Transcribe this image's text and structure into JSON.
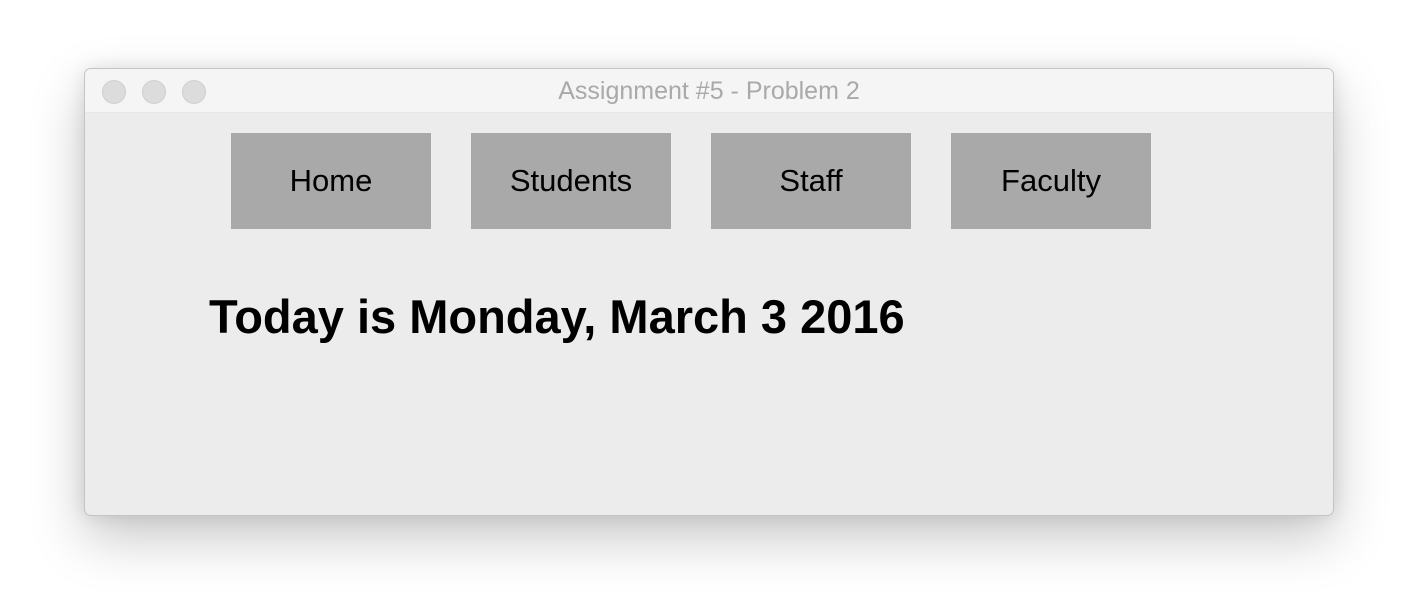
{
  "window": {
    "title": "Assignment #5 - Problem 2"
  },
  "nav": {
    "items": [
      {
        "label": "Home"
      },
      {
        "label": "Students"
      },
      {
        "label": "Staff"
      },
      {
        "label": "Faculty"
      }
    ]
  },
  "main": {
    "date_text": "Today is Monday, March 3 2016"
  },
  "colors": {
    "window_background": "#ececec",
    "titlebar_background": "#f5f5f5",
    "title_text": "#a9a9a9",
    "nav_button_background": "#a9a9a9",
    "text": "#000000"
  }
}
